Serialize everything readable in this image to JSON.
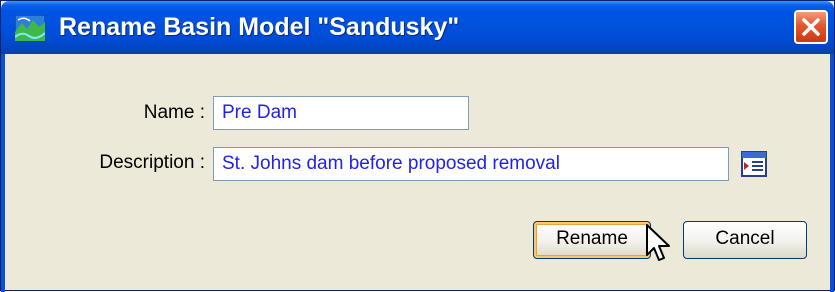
{
  "window": {
    "title": "Rename Basin Model \"Sandusky\"",
    "icon": "basin-model-icon",
    "close_icon": "close-icon"
  },
  "form": {
    "name_label": "Name :",
    "name_value": "Pre Dam",
    "description_label": "Description :",
    "description_value": "St. Johns dam before proposed removal",
    "picker_icon": "description-editor-icon"
  },
  "buttons": {
    "rename_label": "Rename",
    "cancel_label": "Cancel"
  },
  "colors": {
    "titlebar": "#0054e3",
    "dialog_bg": "#ece9d8",
    "field_text": "#2222ee",
    "close_button": "#e2582e"
  }
}
